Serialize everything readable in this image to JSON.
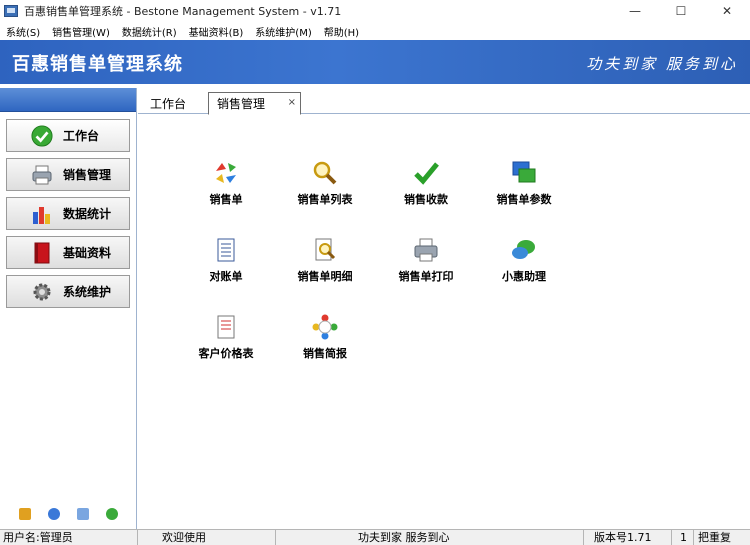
{
  "window": {
    "title": "百惠销售单管理系统 - Bestone Management System - v1.71",
    "minimize": "—",
    "maximize": "☐",
    "close": "✕"
  },
  "menu": [
    {
      "label": "系统(S)"
    },
    {
      "label": "销售管理(W)"
    },
    {
      "label": "数据统计(R)"
    },
    {
      "label": "基础资料(B)"
    },
    {
      "label": "系统维护(M)"
    },
    {
      "label": "帮助(H)"
    }
  ],
  "banner": {
    "title": "百惠销售单管理系统",
    "slogan": "功夫到家 服务到心"
  },
  "nav": [
    {
      "label": "工作台",
      "icon": "green-check-icon"
    },
    {
      "label": "销售管理",
      "icon": "printer-icon"
    },
    {
      "label": "数据统计",
      "icon": "bar-chart-icon"
    },
    {
      "label": "基础资料",
      "icon": "red-book-icon"
    },
    {
      "label": "系统维护",
      "icon": "gear-icon"
    }
  ],
  "nav_footer_icons": [
    "key-icon",
    "clock-icon",
    "monitor-icon",
    "green-circle-icon"
  ],
  "tabs": [
    {
      "label": "工作台"
    },
    {
      "label": "销售管理",
      "close": "×"
    }
  ],
  "functions": [
    {
      "label": "销售单",
      "icon": "recycle-arrows-icon"
    },
    {
      "label": "销售单列表",
      "icon": "magnifier-icon"
    },
    {
      "label": "销售收款",
      "icon": "checkmark-icon"
    },
    {
      "label": "销售单参数",
      "icon": "windows-icon"
    },
    {
      "label": "对账单",
      "icon": "ledger-icon"
    },
    {
      "label": "销售单明细",
      "icon": "document-search-icon"
    },
    {
      "label": "销售单打印",
      "icon": "printer-icon"
    },
    {
      "label": "小惠助理",
      "icon": "chat-bubbles-icon"
    },
    {
      "label": "客户价格表",
      "icon": "price-sheet-icon"
    },
    {
      "label": "销售简报",
      "icon": "people-circle-icon"
    }
  ],
  "status": {
    "user": "用户名:管理员",
    "welcome": "欢迎使用",
    "slogan": "功夫到家 服务到心",
    "version": "版本号1.71",
    "count": "1",
    "extra": "把重复"
  },
  "colors": {
    "banner": "#3c75d0",
    "nav_header": "#2f66c1"
  }
}
